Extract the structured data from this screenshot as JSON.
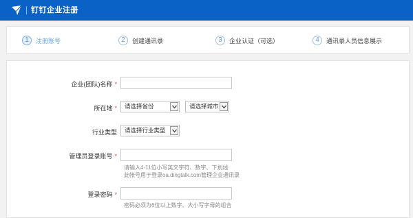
{
  "header": {
    "title": "钉钉企业注册",
    "logo_icon": "dingtalk-logo-icon",
    "brand_color": "#0a62c7"
  },
  "steps": [
    {
      "number": "1",
      "label": "注册账号",
      "active": true
    },
    {
      "number": "2",
      "label": "创建通讯录",
      "active": false
    },
    {
      "number": "3",
      "label": "企业认证（可选）",
      "active": false
    },
    {
      "number": "4",
      "label": "通讯录人员信息展示",
      "active": false
    }
  ],
  "form": {
    "company_name": {
      "label": "企业(团队)名称",
      "required_mark": "*",
      "value": ""
    },
    "location": {
      "label": "所在地",
      "required_mark": "*",
      "province_select": "请选择省份",
      "city_select": "请选择城市"
    },
    "industry": {
      "label": "行业类型",
      "select": "请选择行业类型"
    },
    "admin_account": {
      "label": "管理员登录账号",
      "required_mark": "*",
      "value": "",
      "hint_line1": "请输入4-11位小写英文字符、数字、下划线",
      "hint_line2": "此帐号用于登录oa.dingtalk.com管理企业通讯录"
    },
    "password": {
      "label": "登录密码",
      "required_mark": "*",
      "value": "",
      "hint": "密码必须为6位以上数字、大小写字母的组合"
    }
  }
}
